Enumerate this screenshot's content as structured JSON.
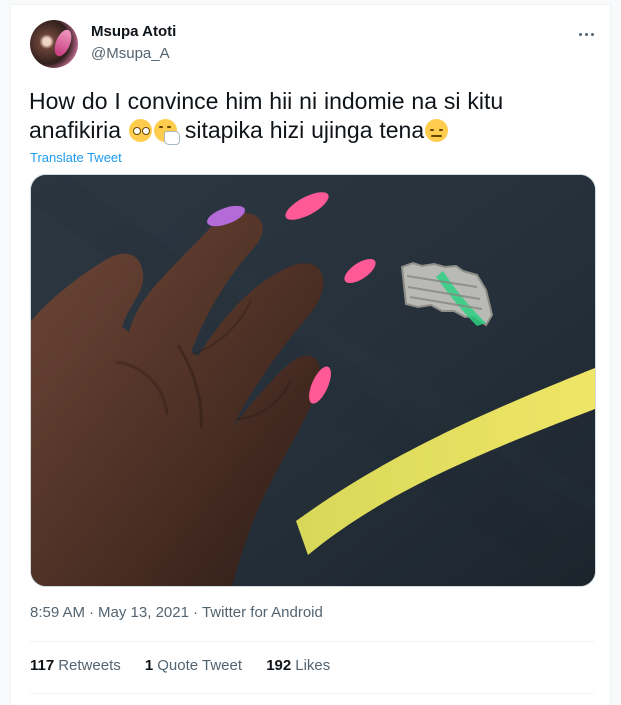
{
  "tweet": {
    "author": {
      "display_name": "Msupa Atoti",
      "handle": "@Msupa_A"
    },
    "text_part_1": "How do I convince him hii ni indomie na si kitu anafikiria",
    "text_part_2": "sitapika hizi ujinga tena",
    "emoji": [
      "face-with-rolling-eyes-icon",
      "sneezing-face-icon",
      "face-with-steam-from-nose-icon"
    ],
    "translate_label": "Translate Tweet",
    "media": {
      "description_label": "",
      "colors": {
        "background": "#242d36",
        "stripe": "#e2dc5f",
        "skin": "#4b3026",
        "nail_pink": "#ff5a96",
        "nail_purple": "#b46ad8",
        "wrapper_green": "#2ed082"
      }
    },
    "time": "8:59 AM",
    "date": "May 13, 2021",
    "source": "Twitter for Android",
    "stats": {
      "retweets_count": "117",
      "retweets_label": "Retweets",
      "quote_count": "1",
      "quote_label": "Quote Tweet",
      "likes_count": "192",
      "likes_label": "Likes"
    }
  }
}
